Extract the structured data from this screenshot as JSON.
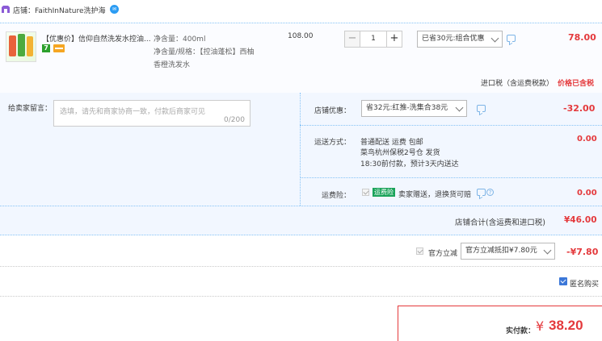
{
  "store": {
    "label": "店铺：FaithInNature洗护海",
    "icon": "store-icon",
    "chat_icon": "wangwang-chat-icon"
  },
  "item": {
    "title": "【优惠价】信仰自然洗发水控油...",
    "sku_line1": "净含量：400ml",
    "sku_line2": "净含量/规格：【控油蓬松】西柚",
    "sku_line3": "香橙洗发水",
    "price": "108.00",
    "quantity": "1",
    "minus_label": "−",
    "plus_label": "+",
    "promo_select": "已省30元:组合优惠",
    "total": "78.00",
    "badge_seven": "7",
    "badge_icons": [
      "seven-day-return-icon",
      "credit-card-icon"
    ]
  },
  "import_tax": {
    "label": "进口税（含运费税款）",
    "status": "价格已含税"
  },
  "message": {
    "label": "给卖家留言：",
    "placeholder": "选填，请先和商家协商一致，付款后商家可见",
    "count": "0/200"
  },
  "coupon": {
    "label": "店铺优惠：",
    "select": "省32元:红推-洗集合38元",
    "amount": "-32.00"
  },
  "shipping": {
    "label": "运送方式：",
    "line1": "普通配送 运费 包邮",
    "line2": "菜鸟杭州保税2号仓  发货",
    "line3": "18:30前付款，预计3天内送达",
    "amount": "0.00"
  },
  "insurance": {
    "label": "运费险：",
    "tag": "运费险",
    "desc": "卖家赠送，退换货可赔",
    "amount": "0.00"
  },
  "store_total": {
    "label": "店铺合计(含运费和进口税)",
    "amount": "¥46.00"
  },
  "official_discount": {
    "label": "官方立减",
    "select": "官方立减抵扣¥7.80元",
    "amount": "-¥7.80"
  },
  "anonymous": {
    "label": "匿名购买"
  },
  "payment": {
    "label": "实付款：",
    "currency": "¥",
    "amount": "38.20"
  },
  "colors": {
    "accent_red": "#e4393c",
    "light_blue_bg": "#f2f7ff",
    "link_blue": "#2b9cf3",
    "green_tag": "#1aa35a"
  }
}
